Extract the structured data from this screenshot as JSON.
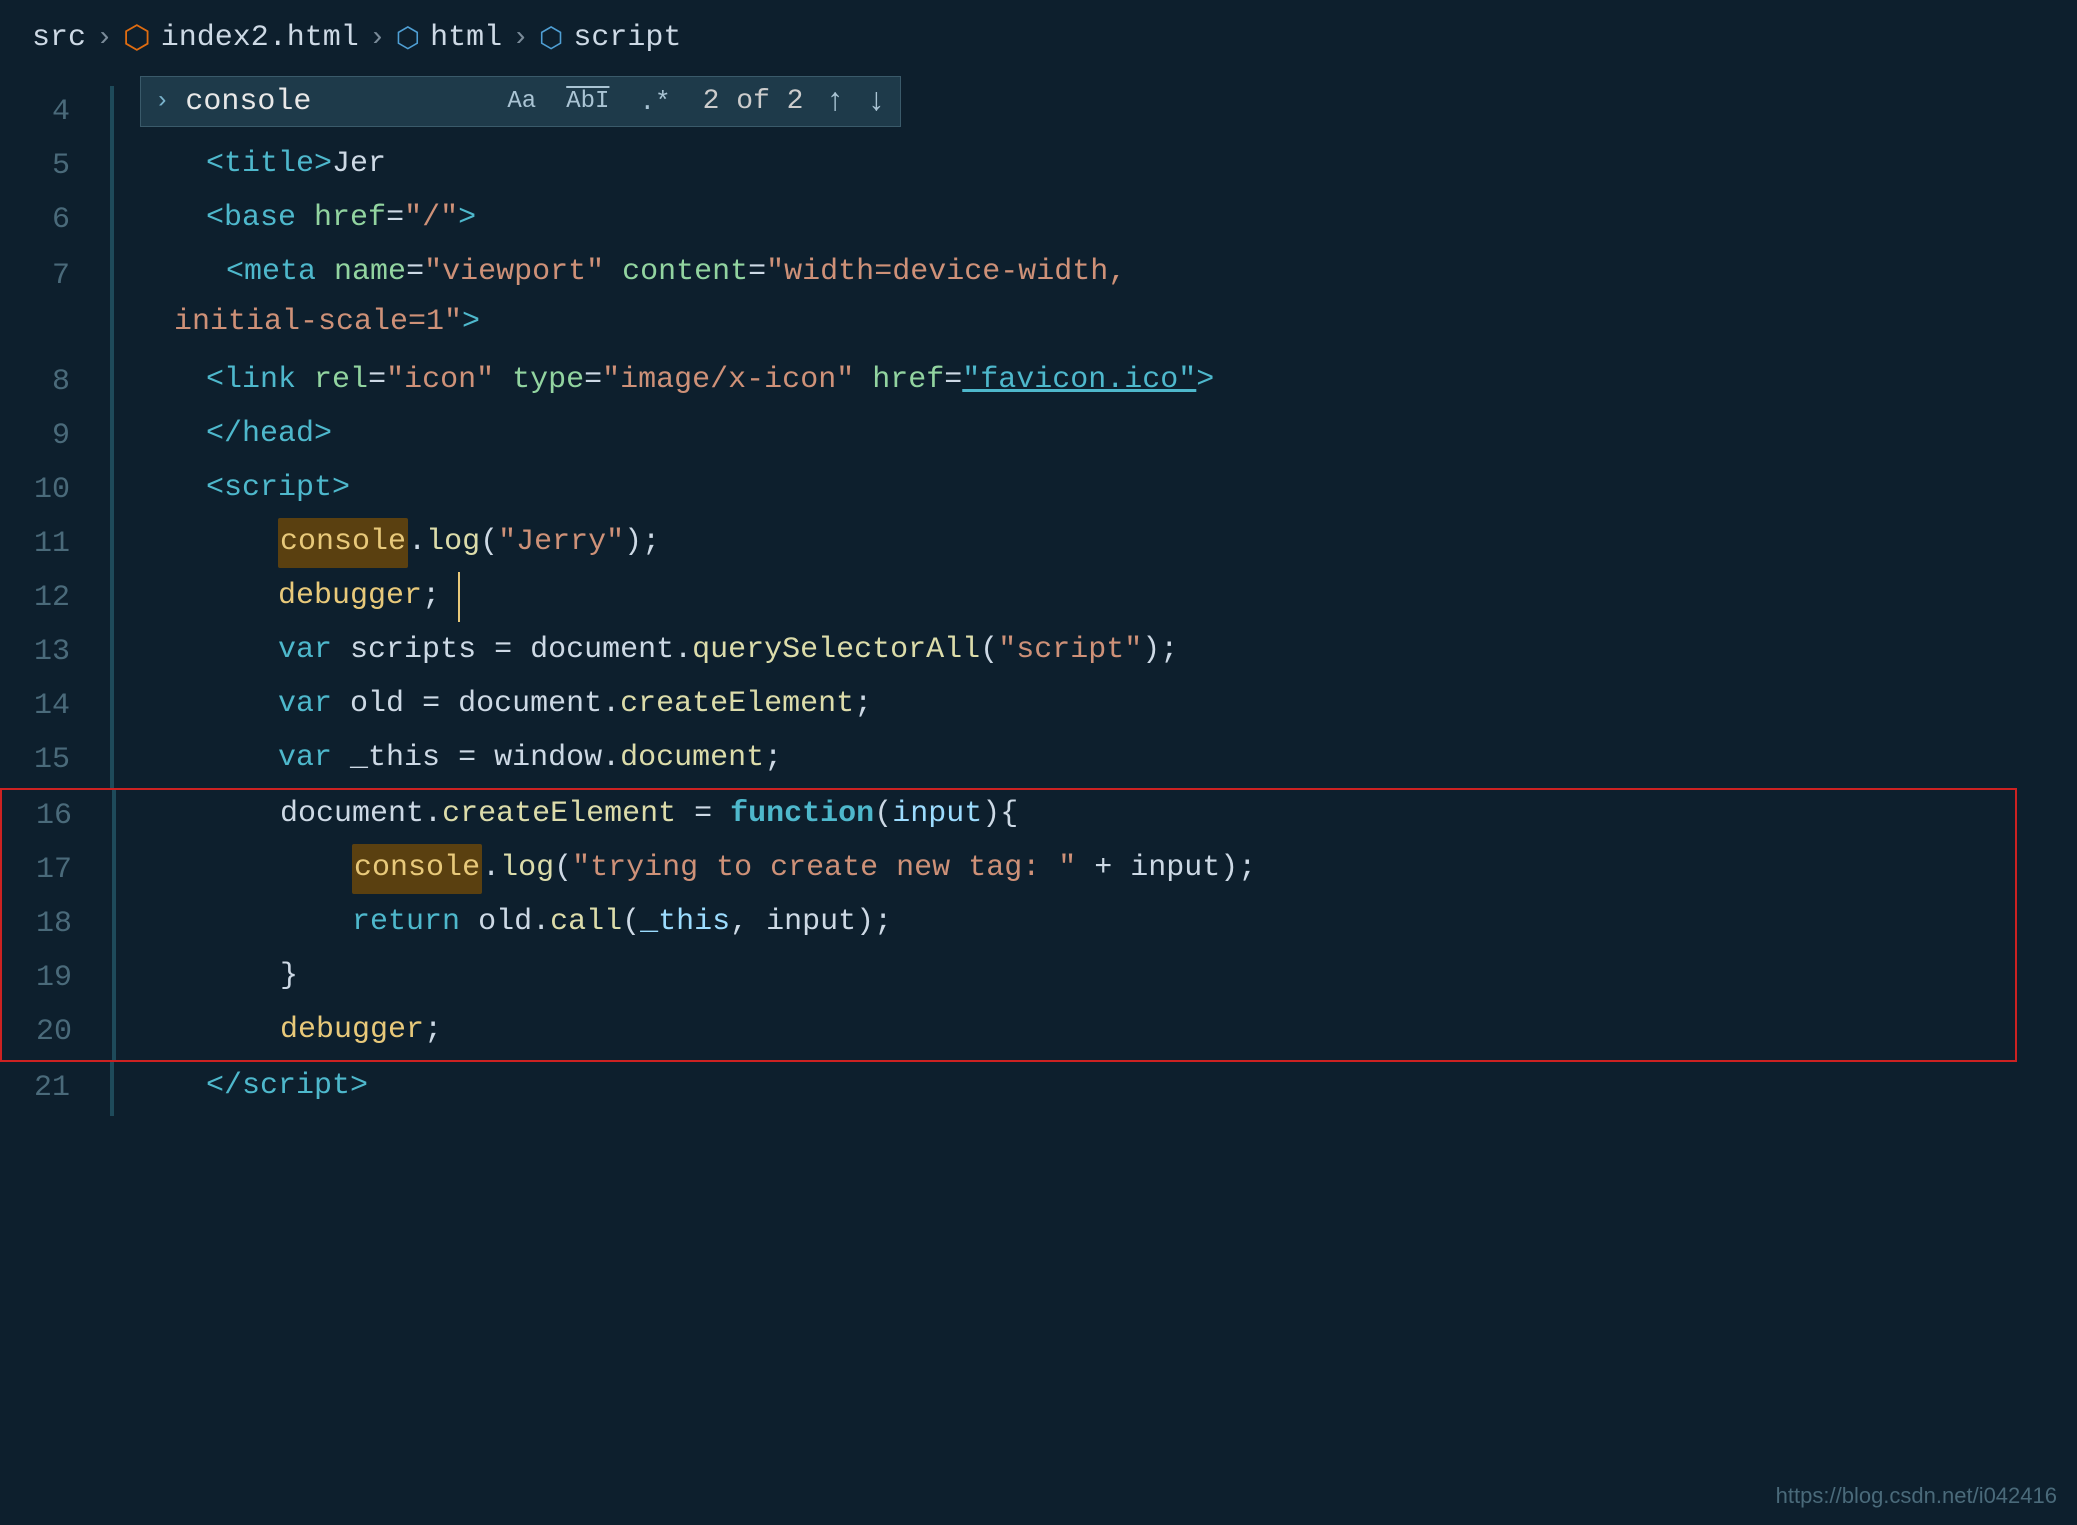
{
  "breadcrumb": {
    "src": "src",
    "sep1": ">",
    "file": "index2.html",
    "sep2": ">",
    "html": "html",
    "sep3": ">",
    "script": "script"
  },
  "findbar": {
    "query": "console",
    "match_case_label": "Aa",
    "whole_word_label": "AbI",
    "regex_label": ".*",
    "count": "2 of 2",
    "nav_up": "↑",
    "nav_down": "↓"
  },
  "lines": [
    {
      "num": "4",
      "content": "meta_char"
    },
    {
      "num": "5",
      "content": "title_jer"
    },
    {
      "num": "6",
      "content": "base_href"
    },
    {
      "num": "7",
      "content": "meta_viewport"
    },
    {
      "num": "8",
      "content": "link_icon"
    },
    {
      "num": "9",
      "content": "close_head"
    },
    {
      "num": "10",
      "content": "open_script"
    },
    {
      "num": "11",
      "content": "console_log"
    },
    {
      "num": "12",
      "content": "debugger1"
    },
    {
      "num": "13",
      "content": "var_scripts"
    },
    {
      "num": "14",
      "content": "var_old"
    },
    {
      "num": "15",
      "content": "var_this"
    },
    {
      "num": "16",
      "content": "createElement_assign"
    },
    {
      "num": "17",
      "content": "console_log2"
    },
    {
      "num": "18",
      "content": "return_old"
    },
    {
      "num": "19",
      "content": "close_brace"
    },
    {
      "num": "20",
      "content": "debugger2"
    },
    {
      "num": "21",
      "content": "close_script"
    }
  ],
  "watermark": {
    "text": "https://blog.csdn.net/i042416"
  }
}
